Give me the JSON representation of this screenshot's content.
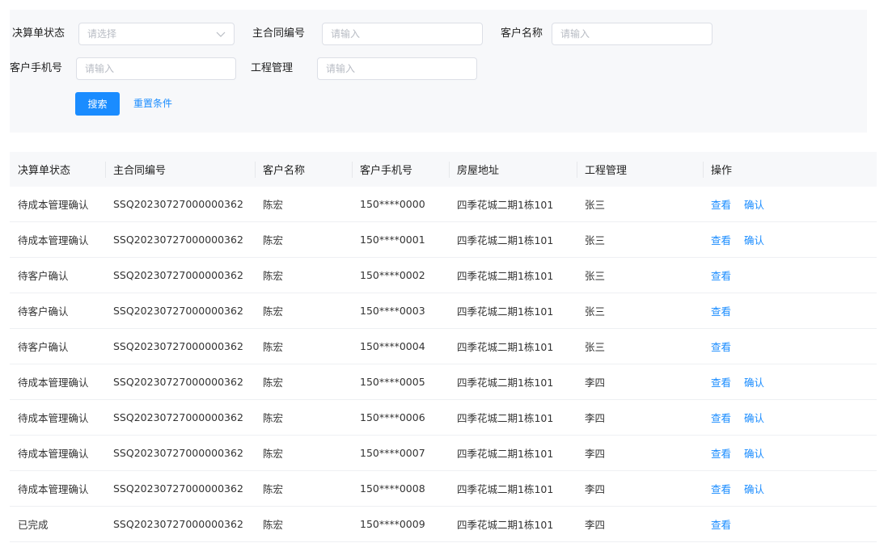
{
  "filters": {
    "status_label": "决算单状态",
    "status_placeholder": "请选择",
    "contract_label": "主合同编号",
    "contract_placeholder": "请输入",
    "customer_label": "客户名称",
    "customer_placeholder": "请输入",
    "phone_label": "客户手机号",
    "phone_placeholder": "请输入",
    "project_label": "工程管理",
    "project_placeholder": "请输入",
    "search_label": "搜索",
    "reset_label": "重置条件"
  },
  "colors": {
    "accent": "#1a8cff",
    "panel_bg": "#f7f8fa"
  },
  "table": {
    "columns": [
      "决算单状态",
      "主合同编号",
      "客户名称",
      "客户手机号",
      "房屋地址",
      "工程管理",
      "操作"
    ],
    "view_label": "查看",
    "confirm_label": "确认",
    "rows": [
      {
        "status": "待成本管理确认",
        "contract": "SSQ20230727000000362",
        "customer": "陈宏",
        "phone": "150****0000",
        "address": "四季花城二期1栋101",
        "manager": "张三",
        "can_confirm": true
      },
      {
        "status": "待成本管理确认",
        "contract": "SSQ20230727000000362",
        "customer": "陈宏",
        "phone": "150****0001",
        "address": "四季花城二期1栋101",
        "manager": "张三",
        "can_confirm": true
      },
      {
        "status": "待客户确认",
        "contract": "SSQ20230727000000362",
        "customer": "陈宏",
        "phone": "150****0002",
        "address": "四季花城二期1栋101",
        "manager": "张三",
        "can_confirm": false
      },
      {
        "status": "待客户确认",
        "contract": "SSQ20230727000000362",
        "customer": "陈宏",
        "phone": "150****0003",
        "address": "四季花城二期1栋101",
        "manager": "张三",
        "can_confirm": false
      },
      {
        "status": "待客户确认",
        "contract": "SSQ20230727000000362",
        "customer": "陈宏",
        "phone": "150****0004",
        "address": "四季花城二期1栋101",
        "manager": "张三",
        "can_confirm": false
      },
      {
        "status": "待成本管理确认",
        "contract": "SSQ20230727000000362",
        "customer": "陈宏",
        "phone": "150****0005",
        "address": "四季花城二期1栋101",
        "manager": "李四",
        "can_confirm": true
      },
      {
        "status": "待成本管理确认",
        "contract": "SSQ20230727000000362",
        "customer": "陈宏",
        "phone": "150****0006",
        "address": "四季花城二期1栋101",
        "manager": "李四",
        "can_confirm": true
      },
      {
        "status": "待成本管理确认",
        "contract": "SSQ20230727000000362",
        "customer": "陈宏",
        "phone": "150****0007",
        "address": "四季花城二期1栋101",
        "manager": "李四",
        "can_confirm": true
      },
      {
        "status": "待成本管理确认",
        "contract": "SSQ20230727000000362",
        "customer": "陈宏",
        "phone": "150****0008",
        "address": "四季花城二期1栋101",
        "manager": "李四",
        "can_confirm": true
      },
      {
        "status": "已完成",
        "contract": "SSQ20230727000000362",
        "customer": "陈宏",
        "phone": "150****0009",
        "address": "四季花城二期1栋101",
        "manager": "李四",
        "can_confirm": false
      }
    ]
  }
}
